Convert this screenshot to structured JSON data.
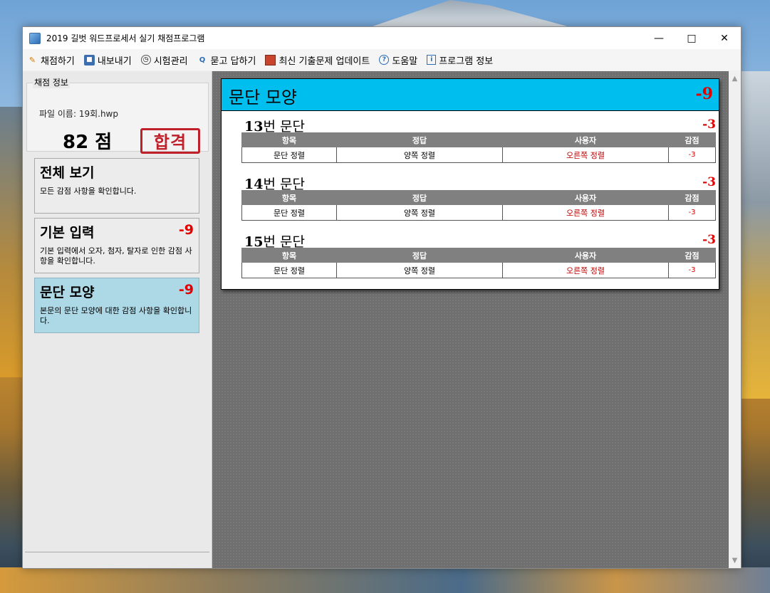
{
  "window": {
    "title": "2019 길벗 워드프로세서 실기 채점프로그램"
  },
  "toolbar": {
    "items": [
      {
        "label": "채점하기",
        "icon": "pencil-icon"
      },
      {
        "label": "내보내기",
        "icon": "save-icon"
      },
      {
        "label": "시험관리",
        "icon": "clock-icon"
      },
      {
        "label": "묻고 답하기",
        "icon": "qa-icon"
      },
      {
        "label": "최신 기출문제 업데이트",
        "icon": "gift-icon"
      },
      {
        "label": "도움말",
        "icon": "help-icon"
      },
      {
        "label": "프로그램 정보",
        "icon": "info-icon"
      }
    ]
  },
  "sidebar": {
    "group_label": "채점 정보",
    "filename": "파일 이름: 19회.hwp",
    "score": "82 점",
    "stamp": "합격",
    "cards": [
      {
        "title": "전체 보기",
        "points": "",
        "desc": "모든 감점 사항을 확인합니다."
      },
      {
        "title": "기본 입력",
        "points": "-9",
        "desc": "기본 입력에서 오자, 첨자, 탈자로 인한 감점 사항을 확인합니다."
      },
      {
        "title": "문단 모양",
        "points": "-9",
        "desc": "본문의 문단 모양에 대한 감점 사항을 확인합니다."
      }
    ]
  },
  "main": {
    "title": "문단 모양",
    "points": "-9",
    "headers": [
      "항목",
      "정답",
      "사용자",
      "감점"
    ],
    "sections": [
      {
        "num": "13",
        "suffix": "번 문단",
        "points": "-3",
        "row": [
          "문단 정렬",
          "양쪽 정렬",
          "오른쪽 정렬",
          "-3"
        ]
      },
      {
        "num": "14",
        "suffix": "번 문단",
        "points": "-3",
        "row": [
          "문단 정렬",
          "양쪽 정렬",
          "오른쪽 정렬",
          "-3"
        ]
      },
      {
        "num": "15",
        "suffix": "번 문단",
        "points": "-3",
        "row": [
          "문단 정렬",
          "양쪽 정렬",
          "오른쪽 정렬",
          "-3"
        ]
      }
    ]
  },
  "colors": {
    "accent": "#00bfef",
    "active_card": "#add8e6",
    "deduct": "#e00000"
  }
}
